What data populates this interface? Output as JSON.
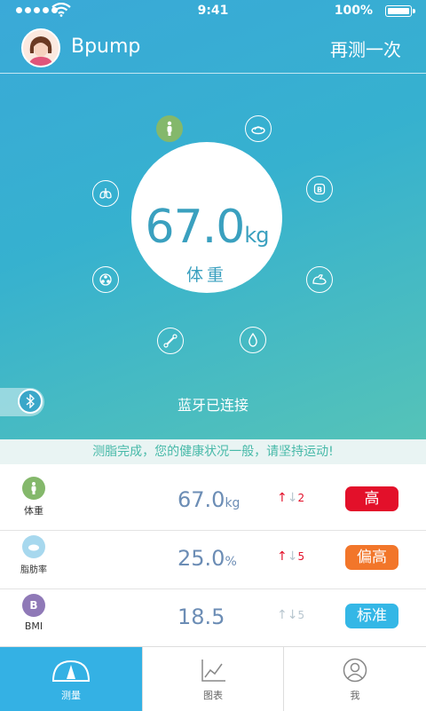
{
  "status_bar": {
    "time": "9:41",
    "battery": "100%"
  },
  "header": {
    "username": "Bpump",
    "retest_label": "再测一次"
  },
  "main_reading": {
    "value": "67.0",
    "unit": "kg",
    "label": "体重"
  },
  "ring_icons": [
    "weight-icon",
    "scale-icon",
    "bmi-icon",
    "muscle-icon",
    "water-icon",
    "bone-icon",
    "metabolism-icon",
    "lungs-icon"
  ],
  "bluetooth": {
    "status": "蓝牙已连接"
  },
  "banner": {
    "message": "测脂完成，您的健康状况一般，请坚持运动!"
  },
  "metrics": [
    {
      "name": "体重",
      "value": "67.0",
      "unit": "kg",
      "trend_value": "2",
      "badge": "高",
      "badge_color": "#e3102a",
      "icon_color": "#84b86b",
      "trend_up_active": true
    },
    {
      "name": "脂肪率",
      "value": "25.0",
      "unit": "%",
      "trend_value": "5",
      "badge": "偏高",
      "badge_color": "#f2762a",
      "icon_color": "#a7d8ee",
      "trend_up_active": true
    },
    {
      "name": "BMI",
      "value": "18.5",
      "unit": "",
      "trend_value": "5",
      "badge": "标准",
      "badge_color": "#34b7e6",
      "icon_color": "#8f79b7",
      "icon_text": "B",
      "trend_up_active": false
    }
  ],
  "tabs": [
    {
      "label": "测量",
      "active": true
    },
    {
      "label": "图表",
      "active": false
    },
    {
      "label": "我",
      "active": false
    }
  ],
  "colors": {
    "accent": "#34b1e4",
    "value_text": "#6c8db5",
    "trend_up": "#e3102a",
    "trend_muted": "#b8c6cf"
  }
}
